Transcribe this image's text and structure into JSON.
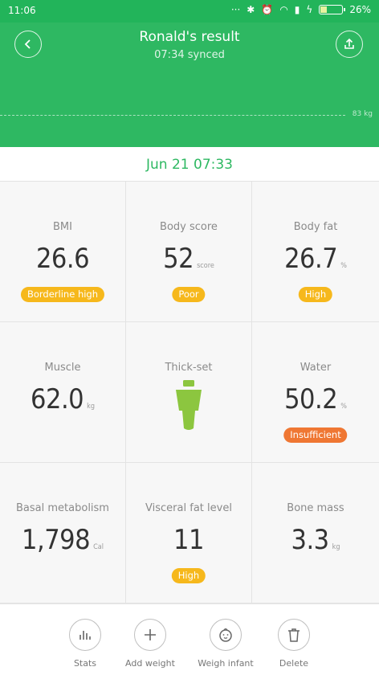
{
  "status_bar": {
    "time": "11:06",
    "battery": "26%",
    "battery_level": 0.26
  },
  "header": {
    "title": "Ronald's result",
    "subtitle": "07:34 synced",
    "chart_line_label": "83 kg"
  },
  "date": "Jun 21 07:33",
  "metrics": [
    {
      "label": "BMI",
      "value": "26.6",
      "unit": "",
      "badge": "Borderline high",
      "badge_color": "#f6b81c"
    },
    {
      "label": "Body score",
      "value": "52",
      "unit": "score",
      "badge": "Poor",
      "badge_color": "#f6b81c"
    },
    {
      "label": "Body fat",
      "value": "26.7",
      "unit": "%",
      "badge": "High",
      "badge_color": "#f6b81c"
    },
    {
      "label": "Muscle",
      "value": "62.0",
      "unit": "kg",
      "badge": ""
    },
    {
      "label": "Thick-set",
      "value": "",
      "unit": "",
      "badge": "",
      "icon": "body-type-figure-icon"
    },
    {
      "label": "Water",
      "value": "50.2",
      "unit": "%",
      "badge": "Insufficient",
      "badge_color": "#ef7733"
    },
    {
      "label": "Basal metabolism",
      "value": "1,798",
      "unit": "Cal",
      "badge": ""
    },
    {
      "label": "Visceral fat level",
      "value": "11",
      "unit": "",
      "badge": "High",
      "badge_color": "#f6b81c"
    },
    {
      "label": "Bone mass",
      "value": "3.3",
      "unit": "kg",
      "badge": ""
    }
  ],
  "actions": [
    {
      "label": "Stats",
      "icon": "stats-icon"
    },
    {
      "label": "Add weight",
      "icon": "plus-icon"
    },
    {
      "label": "Weigh infant",
      "icon": "baby-face-icon"
    },
    {
      "label": "Delete",
      "icon": "trash-icon"
    }
  ],
  "colors": {
    "accent": "#2eb862",
    "badge_yellow": "#f6b81c",
    "badge_orange": "#ef7733",
    "figure": "#8cc63f"
  }
}
